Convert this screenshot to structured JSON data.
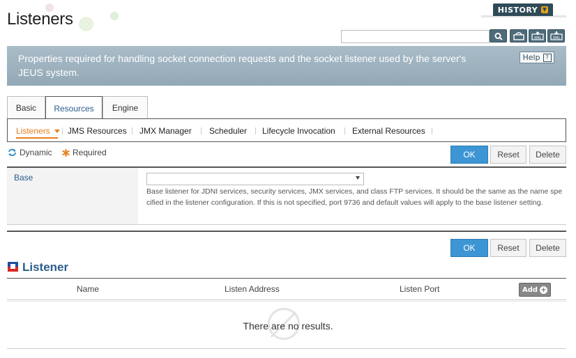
{
  "header": {
    "title": "Listeners",
    "history_label": "HISTORY",
    "search": {
      "value": "",
      "placeholder": ""
    },
    "toolbar_icons": [
      "search-icon",
      "refresh-icon",
      "xml-upload-icon",
      "xml-download-icon"
    ]
  },
  "info": {
    "text": "Properties required for handling socket connection requests and the socket listener used by the server's JEUS system.",
    "help_label": "Help",
    "help_glyph": "?"
  },
  "tabs": [
    {
      "label": "Basic",
      "active": false
    },
    {
      "label": "Resources",
      "active": true
    },
    {
      "label": "Engine",
      "active": false
    }
  ],
  "subnav": [
    {
      "label": "Listeners",
      "active": true
    },
    {
      "label": "JMS Resources",
      "active": false
    },
    {
      "label": "JMX Manager",
      "active": false
    },
    {
      "label": "Scheduler",
      "active": false
    },
    {
      "label": "Lifecycle Invocation",
      "active": false
    },
    {
      "label": "External Resources",
      "active": false
    }
  ],
  "legend": {
    "dynamic": "Dynamic",
    "required": "Required"
  },
  "buttons": {
    "ok": "OK",
    "reset": "Reset",
    "delete": "Delete"
  },
  "form": {
    "base_label": "Base",
    "base_value": "",
    "base_description": "Base listener for JDNI services, security services, JMX services, and class FTP services. It should be the same as the name specified in the listener configuration. If this is not specified, port 9736 and default values will apply to the base listener setting."
  },
  "listener_section": {
    "title": "Listener",
    "columns": [
      "Name",
      "Listen Address",
      "Listen Port"
    ],
    "add_label": "Add",
    "add_glyph": "+",
    "empty_text": "There are no results."
  },
  "colors": {
    "accent_blue": "#2b5d8d",
    "ok_button": "#3d95d3",
    "active_subnav": "#e87d1e",
    "info_bar": "#9eb2bf"
  }
}
